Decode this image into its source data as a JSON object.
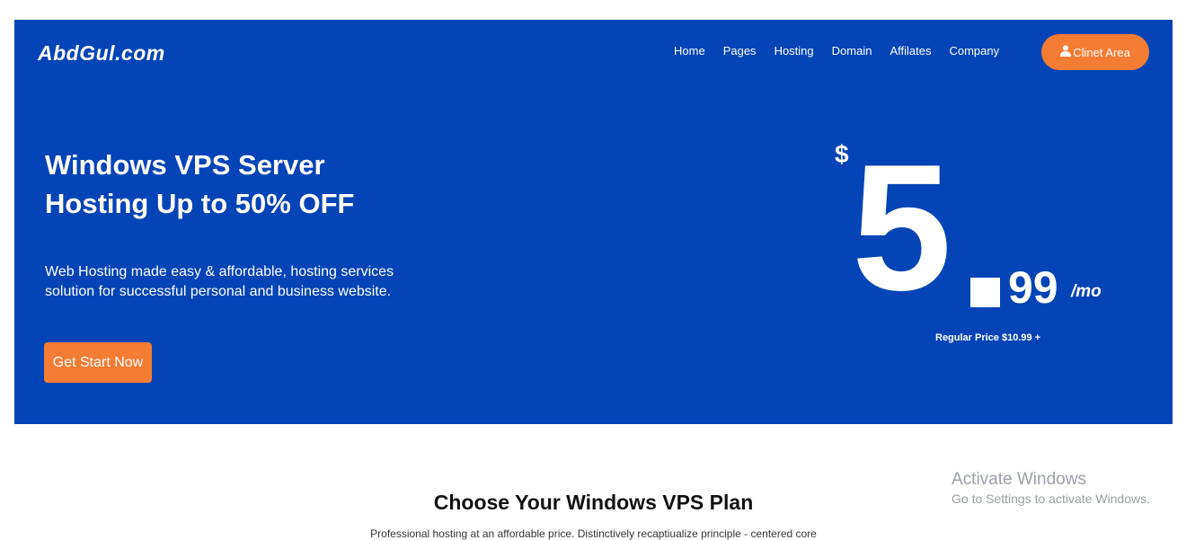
{
  "header": {
    "logo": "AbdGul.com",
    "nav": [
      "Home",
      "Pages",
      "Hosting",
      "Domain",
      "Affilates",
      "Company"
    ],
    "client_button": {
      "icon": "user-icon",
      "label": "Clinet Area"
    }
  },
  "hero": {
    "title": "Windows VPS Server Hosting Up to 50% OFF",
    "subtitle": "Web Hosting made easy & affordable, hosting services solution for successful personal and business website.",
    "cta_label": "Get Start Now",
    "price": {
      "currency": "$",
      "whole": "5",
      "cents": "99",
      "period": "/mo",
      "regular": "Regular Price $10.99 +"
    }
  },
  "plans_section": {
    "title": "Choose Your Windows VPS Plan",
    "subtitle": "Professional hosting at an affordable price. Distinctively recaptiualize principle - centered core"
  },
  "watermark": {
    "title": "Activate Windows",
    "subtitle": "Go to Settings to activate Windows."
  },
  "colors": {
    "hero_background": "#0444b6",
    "accent_orange": "#f47c33",
    "text_white": "#ffffff"
  }
}
